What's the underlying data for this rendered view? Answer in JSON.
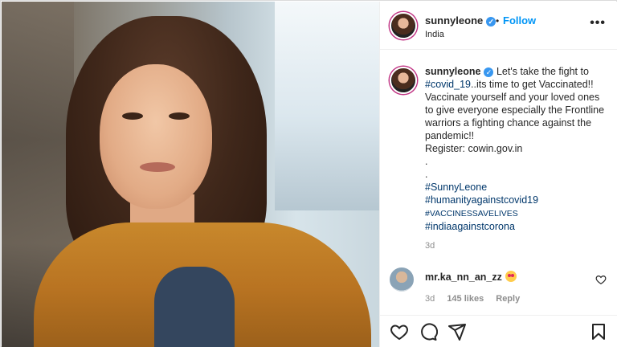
{
  "post": {
    "username": "sunnyleone",
    "follow_label": "Follow",
    "dot": "•",
    "location": "India",
    "more_label": "•••"
  },
  "caption": {
    "username": "sunnyleone",
    "text_1": "Let's take the fight to",
    "hashtag_covid": "#covid_19",
    "text_2": "..its time to get Vaccinated!! Vaccinate yourself and your loved ones to give everyone especially the Frontline warriors a fighting chance against the pandemic!!",
    "register": "Register: cowin.gov.in",
    "dot_line": ".",
    "tag_1": "#SunnyLeone",
    "tag_2": "#humanityagainstcovid19",
    "tag_3": "#VACCINESSAVELIVES",
    "tag_4": "#indiaagainstcorona",
    "time": "3d"
  },
  "reply": {
    "username": "mr.ka_nn_an_zz",
    "emoji": "heart-eyes-emoji",
    "time": "3d",
    "likes": "145 likes",
    "reply_label": "Reply"
  },
  "icons": [
    "heart-icon",
    "comment-icon",
    "share-icon",
    "bookmark-icon",
    "more-icon",
    "verified-icon",
    "small-heart-icon"
  ],
  "colors": {
    "link": "#00376b",
    "follow": "#0095f6",
    "verified": "#3897f0",
    "muted": "#8e8e8e"
  }
}
